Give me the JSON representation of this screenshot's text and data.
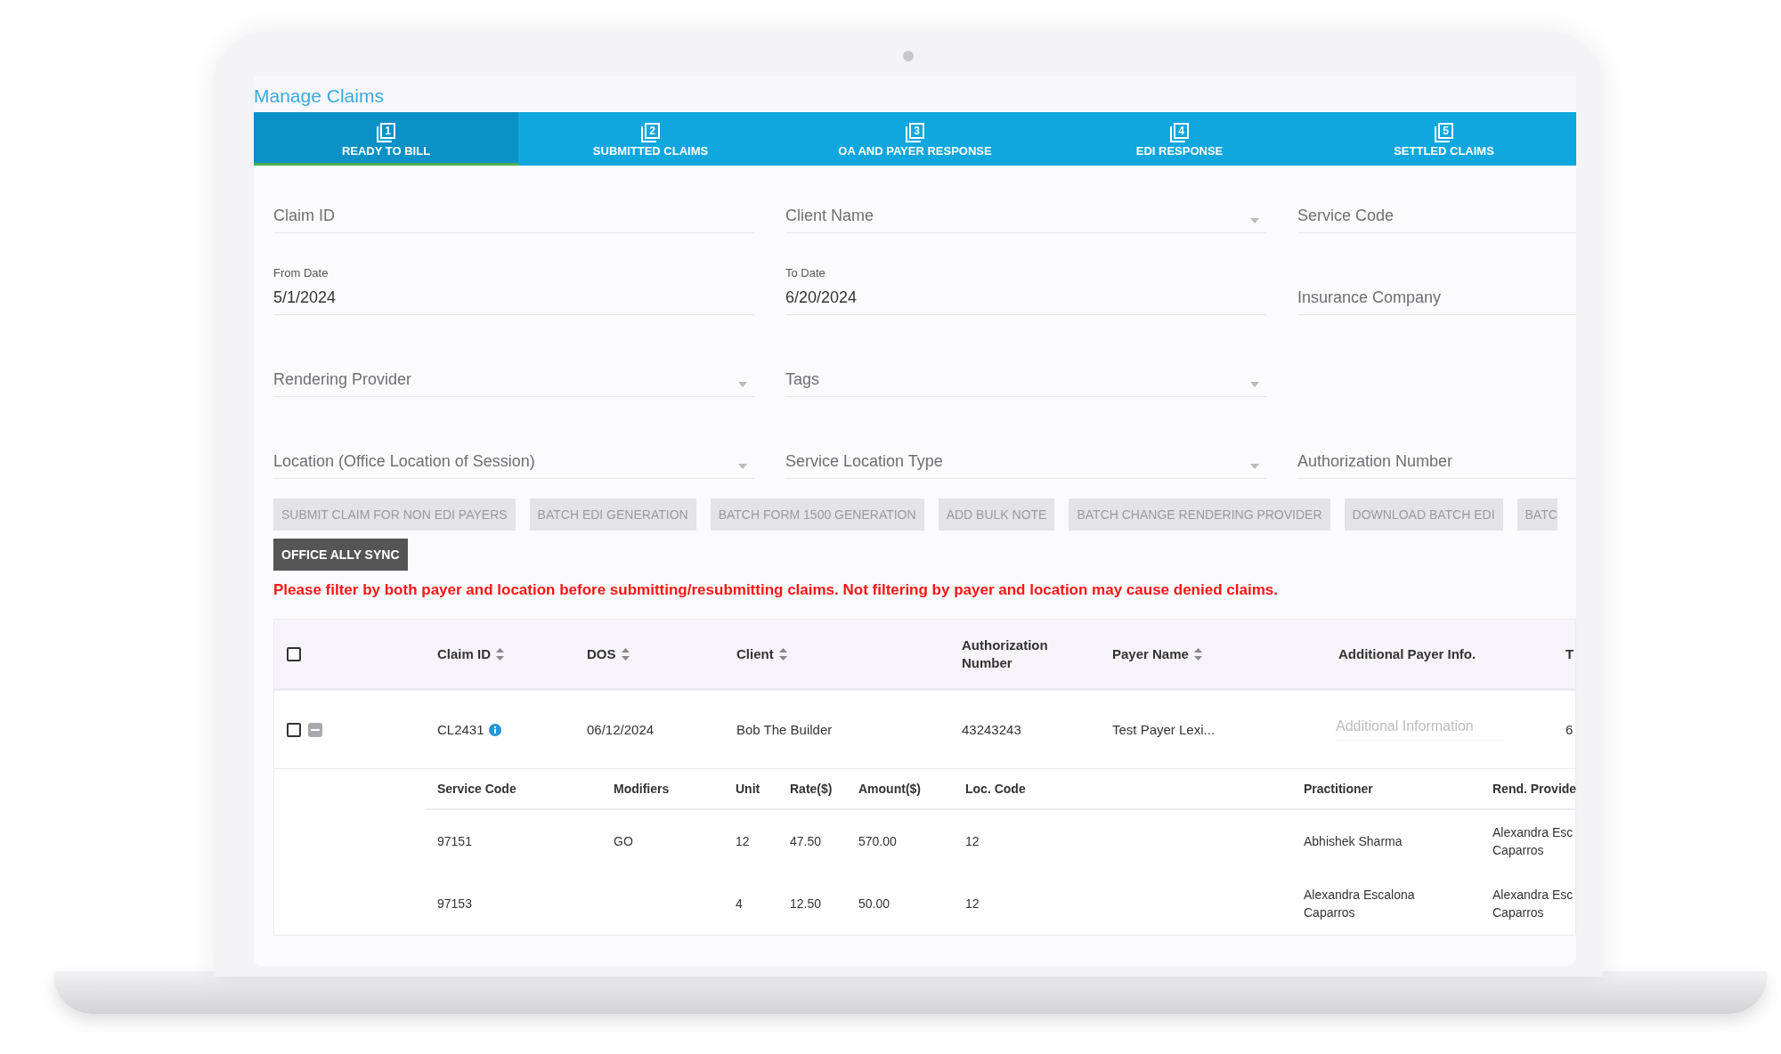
{
  "title": "Manage Claims",
  "tabs": [
    {
      "number": "1",
      "label": "READY TO BILL",
      "selected": true
    },
    {
      "number": "2",
      "label": "SUBMITTED CLAIMS",
      "selected": false
    },
    {
      "number": "3",
      "label": "OA AND PAYER RESPONSE",
      "selected": false
    },
    {
      "number": "4",
      "label": "EDI RESPONSE",
      "selected": false
    },
    {
      "number": "5",
      "label": "SETTLED CLAIMS",
      "selected": false
    }
  ],
  "filter_rows": [
    [
      {
        "label": "Claim ID",
        "dropdown": false
      },
      {
        "label": "Client Name",
        "dropdown": true
      },
      {
        "label": "Service Code",
        "dropdown": false
      }
    ],
    [
      {
        "label": "From Date",
        "value": "5/1/2024",
        "dropdown": false
      },
      {
        "label": "To Date",
        "value": "6/20/2024",
        "dropdown": false
      },
      {
        "label": "Insurance Company",
        "dropdown": false
      }
    ],
    [
      {
        "label": "Rendering Provider",
        "dropdown": true
      },
      {
        "label": "Tags",
        "dropdown": true
      }
    ],
    [
      {
        "label": "Location (Office Location of Session)",
        "dropdown": true
      },
      {
        "label": "Service Location Type",
        "dropdown": true
      },
      {
        "label": "Authorization Number",
        "dropdown": false
      }
    ]
  ],
  "bulk_actions": [
    {
      "label": "SUBMIT CLAIM FOR NON EDI PAYERS",
      "disabled": true
    },
    {
      "label": "BATCH EDI GENERATION",
      "disabled": true
    },
    {
      "label": "BATCH FORM 1500 GENERATION",
      "disabled": true
    },
    {
      "label": "ADD BULK NOTE",
      "disabled": true
    },
    {
      "label": "BATCH CHANGE RENDERING PROVIDER",
      "disabled": true
    },
    {
      "label": "DOWNLOAD BATCH EDI",
      "disabled": true
    },
    {
      "label": "BATC",
      "disabled": true
    }
  ],
  "sync_button": {
    "label": "OFFICE ALLY SYNC",
    "disabled": false
  },
  "warning": "Please filter by both payer and location before submitting/resubmitting claims. Not filtering by payer and location may cause denied claims.",
  "table": {
    "select_all_checked": false,
    "columns": [
      {
        "label": "Claim ID",
        "sortable": true
      },
      {
        "label": "DOS",
        "sortable": true
      },
      {
        "label": "Client",
        "sortable": true
      },
      {
        "label": "Authorization\nNumber",
        "sortable": false
      },
      {
        "label": "Payer Name",
        "sortable": true
      },
      {
        "label": "Additional Payer Info.",
        "sortable": false
      },
      {
        "label": "T",
        "sortable": false
      }
    ],
    "rows": [
      {
        "checked": false,
        "expanded": true,
        "claim_id": "CL2431",
        "dos": "06/12/2024",
        "client": "Bob The Builder",
        "authorization_number": "43243243",
        "payer_name": "Test Payer Lexi...",
        "additional_info_placeholder": "Additional Information",
        "column_8": "6",
        "services": {
          "columns": [
            "Service Code",
            "Modifiers",
            "Unit",
            "Rate($)",
            "Amount($)",
            "Loc. Code",
            "Practitioner",
            "Rend. Provide"
          ],
          "rows": [
            [
              "97151",
              "GO",
              "12",
              "47.50",
              "570.00",
              "12",
              "Abhishek Sharma",
              "Alexandra Esc\nCaparros"
            ],
            [
              "97153",
              "",
              "4",
              "12.50",
              "50.00",
              "12",
              "Alexandra Escalona\nCaparros",
              "Alexandra Esc\nCaparros"
            ]
          ]
        }
      }
    ]
  }
}
